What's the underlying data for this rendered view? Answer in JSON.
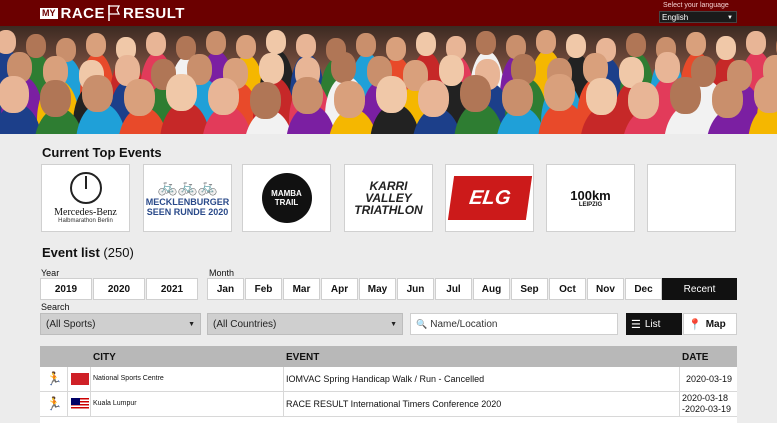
{
  "header": {
    "logo_my": "MY",
    "logo_race": "RACE",
    "logo_result": "RESULT",
    "language_label": "Select your language",
    "language_value": "English"
  },
  "top_events": {
    "title": "Current Top Events",
    "cards": [
      {
        "name": "Mercedes-Benz",
        "sub": "Halbmarathon Berlin"
      },
      {
        "line1": "MECKLENBURGER",
        "line2": "SEEN RUNDE 2020"
      },
      {
        "name": "MAMBA TRAIL"
      },
      {
        "line1": "KARRI VALLEY",
        "line2": "TRIATHLON"
      },
      {
        "name": "ELG"
      },
      {
        "name": "100km",
        "sub": "LEIPZIG"
      },
      {
        "name": ""
      }
    ]
  },
  "event_list": {
    "title": "Event list",
    "count": "(250)",
    "year_label": "Year",
    "years": [
      "2019",
      "2020",
      "2021"
    ],
    "month_label": "Month",
    "months": [
      "Jan",
      "Feb",
      "Mar",
      "Apr",
      "May",
      "Jun",
      "Jul",
      "Aug",
      "Sep",
      "Oct",
      "Nov",
      "Dec"
    ],
    "recent_label": "Recent",
    "search_label": "Search",
    "sports_value": "(All Sports)",
    "countries_value": "(All Countries)",
    "location_placeholder": "Name/Location",
    "list_label": "List",
    "map_label": "Map"
  },
  "table": {
    "headers": {
      "city": "CITY",
      "event": "EVENT",
      "date": "DATE"
    },
    "rows": [
      {
        "city": "National Sports Centre",
        "event": "IOMVAC Spring Handicap Walk / Run - Cancelled",
        "date": "2020-03-19",
        "flag_color": "#cf2027"
      },
      {
        "city": "Kuala Lumpur",
        "event": "RACE RESULT International Timers Conference 2020",
        "date": "2020-03-18",
        "date_end": "-2020-03-19",
        "flag_color": "#cc0001"
      }
    ]
  },
  "colors": {
    "brand": "#6b0000",
    "active_button": "#111111"
  }
}
